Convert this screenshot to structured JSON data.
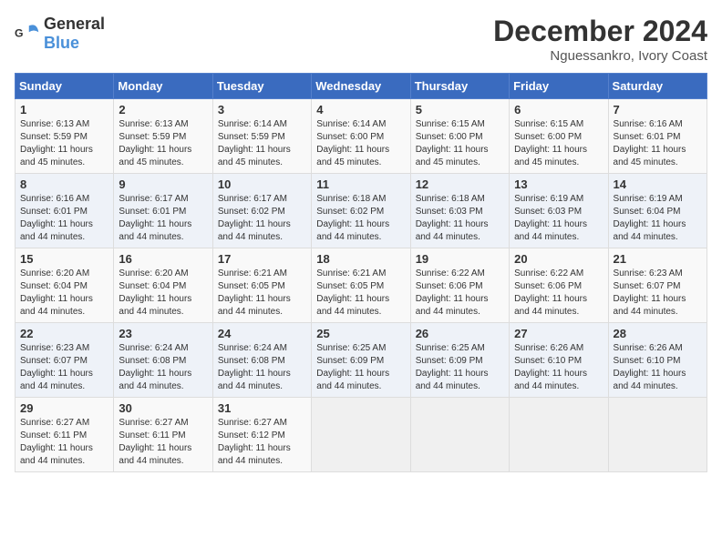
{
  "logo": {
    "general": "General",
    "blue": "Blue"
  },
  "title": "December 2024",
  "location": "Nguessankro, Ivory Coast",
  "days_of_week": [
    "Sunday",
    "Monday",
    "Tuesday",
    "Wednesday",
    "Thursday",
    "Friday",
    "Saturday"
  ],
  "weeks": [
    [
      {
        "day": "1",
        "sunrise": "6:13 AM",
        "sunset": "5:59 PM",
        "daylight": "11 hours and 45 minutes."
      },
      {
        "day": "2",
        "sunrise": "6:13 AM",
        "sunset": "5:59 PM",
        "daylight": "11 hours and 45 minutes."
      },
      {
        "day": "3",
        "sunrise": "6:14 AM",
        "sunset": "5:59 PM",
        "daylight": "11 hours and 45 minutes."
      },
      {
        "day": "4",
        "sunrise": "6:14 AM",
        "sunset": "6:00 PM",
        "daylight": "11 hours and 45 minutes."
      },
      {
        "day": "5",
        "sunrise": "6:15 AM",
        "sunset": "6:00 PM",
        "daylight": "11 hours and 45 minutes."
      },
      {
        "day": "6",
        "sunrise": "6:15 AM",
        "sunset": "6:00 PM",
        "daylight": "11 hours and 45 minutes."
      },
      {
        "day": "7",
        "sunrise": "6:16 AM",
        "sunset": "6:01 PM",
        "daylight": "11 hours and 45 minutes."
      }
    ],
    [
      {
        "day": "8",
        "sunrise": "6:16 AM",
        "sunset": "6:01 PM",
        "daylight": "11 hours and 44 minutes."
      },
      {
        "day": "9",
        "sunrise": "6:17 AM",
        "sunset": "6:01 PM",
        "daylight": "11 hours and 44 minutes."
      },
      {
        "day": "10",
        "sunrise": "6:17 AM",
        "sunset": "6:02 PM",
        "daylight": "11 hours and 44 minutes."
      },
      {
        "day": "11",
        "sunrise": "6:18 AM",
        "sunset": "6:02 PM",
        "daylight": "11 hours and 44 minutes."
      },
      {
        "day": "12",
        "sunrise": "6:18 AM",
        "sunset": "6:03 PM",
        "daylight": "11 hours and 44 minutes."
      },
      {
        "day": "13",
        "sunrise": "6:19 AM",
        "sunset": "6:03 PM",
        "daylight": "11 hours and 44 minutes."
      },
      {
        "day": "14",
        "sunrise": "6:19 AM",
        "sunset": "6:04 PM",
        "daylight": "11 hours and 44 minutes."
      }
    ],
    [
      {
        "day": "15",
        "sunrise": "6:20 AM",
        "sunset": "6:04 PM",
        "daylight": "11 hours and 44 minutes."
      },
      {
        "day": "16",
        "sunrise": "6:20 AM",
        "sunset": "6:04 PM",
        "daylight": "11 hours and 44 minutes."
      },
      {
        "day": "17",
        "sunrise": "6:21 AM",
        "sunset": "6:05 PM",
        "daylight": "11 hours and 44 minutes."
      },
      {
        "day": "18",
        "sunrise": "6:21 AM",
        "sunset": "6:05 PM",
        "daylight": "11 hours and 44 minutes."
      },
      {
        "day": "19",
        "sunrise": "6:22 AM",
        "sunset": "6:06 PM",
        "daylight": "11 hours and 44 minutes."
      },
      {
        "day": "20",
        "sunrise": "6:22 AM",
        "sunset": "6:06 PM",
        "daylight": "11 hours and 44 minutes."
      },
      {
        "day": "21",
        "sunrise": "6:23 AM",
        "sunset": "6:07 PM",
        "daylight": "11 hours and 44 minutes."
      }
    ],
    [
      {
        "day": "22",
        "sunrise": "6:23 AM",
        "sunset": "6:07 PM",
        "daylight": "11 hours and 44 minutes."
      },
      {
        "day": "23",
        "sunrise": "6:24 AM",
        "sunset": "6:08 PM",
        "daylight": "11 hours and 44 minutes."
      },
      {
        "day": "24",
        "sunrise": "6:24 AM",
        "sunset": "6:08 PM",
        "daylight": "11 hours and 44 minutes."
      },
      {
        "day": "25",
        "sunrise": "6:25 AM",
        "sunset": "6:09 PM",
        "daylight": "11 hours and 44 minutes."
      },
      {
        "day": "26",
        "sunrise": "6:25 AM",
        "sunset": "6:09 PM",
        "daylight": "11 hours and 44 minutes."
      },
      {
        "day": "27",
        "sunrise": "6:26 AM",
        "sunset": "6:10 PM",
        "daylight": "11 hours and 44 minutes."
      },
      {
        "day": "28",
        "sunrise": "6:26 AM",
        "sunset": "6:10 PM",
        "daylight": "11 hours and 44 minutes."
      }
    ],
    [
      {
        "day": "29",
        "sunrise": "6:27 AM",
        "sunset": "6:11 PM",
        "daylight": "11 hours and 44 minutes."
      },
      {
        "day": "30",
        "sunrise": "6:27 AM",
        "sunset": "6:11 PM",
        "daylight": "11 hours and 44 minutes."
      },
      {
        "day": "31",
        "sunrise": "6:27 AM",
        "sunset": "6:12 PM",
        "daylight": "11 hours and 44 minutes."
      },
      null,
      null,
      null,
      null
    ]
  ]
}
